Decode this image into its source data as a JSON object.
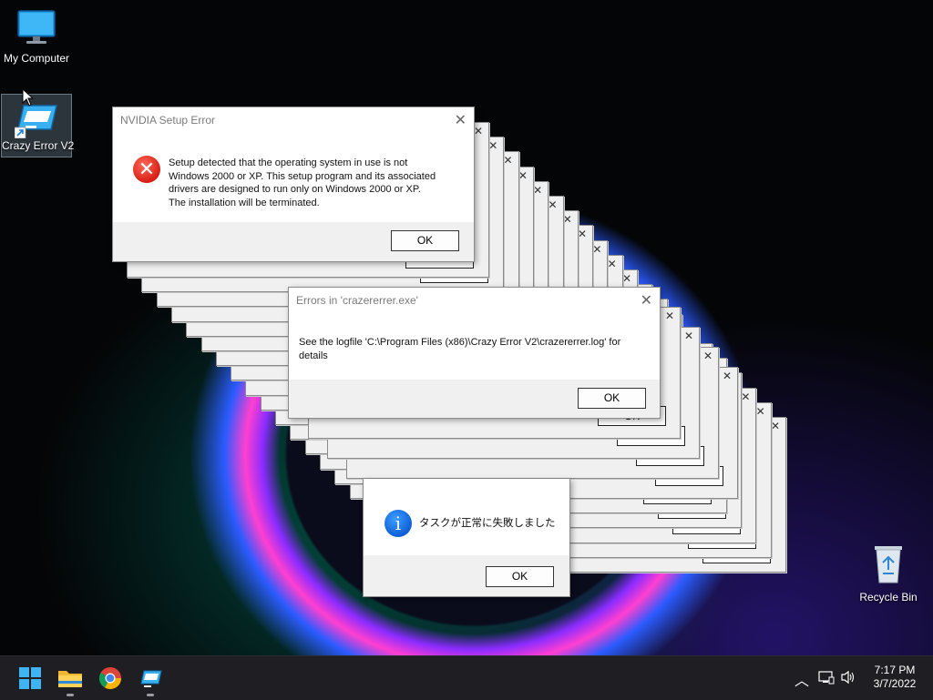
{
  "desktop": {
    "icons": [
      {
        "label": "My Computer"
      },
      {
        "label": "Crazy Error V2"
      },
      {
        "label": "Recycle Bin"
      }
    ]
  },
  "dialogs": {
    "nvidia": {
      "title": "NVIDIA Setup Error",
      "message_lines": [
        "Setup detected that the operating system in use is not",
        "Windows 2000 or XP. This setup program and its associated",
        "drivers are designed to run only on Windows 2000 or XP.",
        "The installation will be terminated."
      ],
      "ok": "OK",
      "close": "✕"
    },
    "crazerrer": {
      "title": "Errors in 'crazererrer.exe'",
      "message_lines": [
        "See the logfile 'C:\\Program Files (x86)\\Crazy Error V2\\crazererrer.log' for",
        "details"
      ],
      "ok": "OK",
      "close": "✕"
    },
    "task": {
      "message": "タスクが正常に失敗しました",
      "ok": "OK"
    },
    "stack_ok": "OK",
    "stack_close": "✕"
  },
  "taskbar": {
    "time": "7:17 PM",
    "date": "3/7/2022",
    "apps": [
      "start-button",
      "file-explorer",
      "chrome",
      "crazy-error-v2"
    ]
  },
  "colors": {
    "error_red": "#d81e14",
    "info_blue": "#0f5fd6",
    "taskbar": "#1f1f23"
  }
}
